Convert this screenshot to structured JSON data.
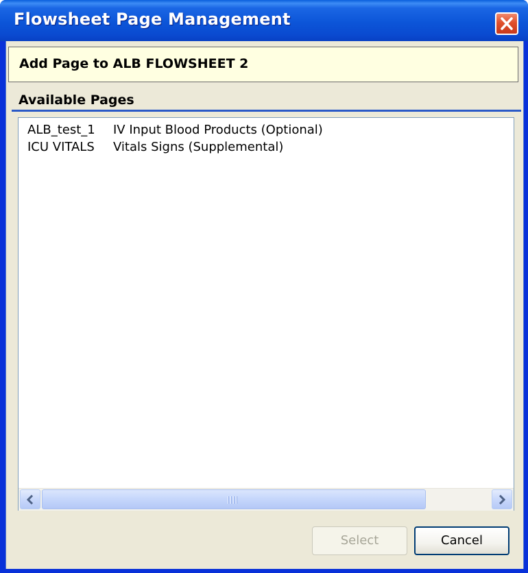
{
  "window": {
    "title": "Flowsheet Page Management",
    "close_icon": "close-icon"
  },
  "banner": {
    "text": "Add Page to ALB FLOWSHEET 2"
  },
  "available_pages": {
    "label": "Available Pages",
    "items": [
      {
        "code": "ALB_test_1",
        "description": "IV Input Blood Products (Optional)"
      },
      {
        "code": "ICU VITALS",
        "description": "Vitals Signs (Supplemental)"
      }
    ]
  },
  "scrollbar": {
    "left_icon": "chevron-left-icon",
    "right_icon": "chevron-right-icon"
  },
  "buttons": {
    "select_label": "Select",
    "cancel_label": "Cancel"
  },
  "colors": {
    "title_bar": "#0a55d8",
    "banner_background": "#ffffe1",
    "dialog_background": "#ece9d8",
    "section_rule": "#2a59c7"
  }
}
